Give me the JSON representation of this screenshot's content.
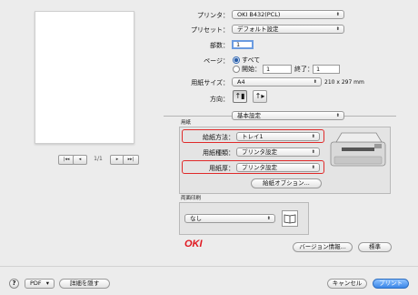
{
  "printer": {
    "label": "プリンタ：",
    "value": "OKI B432(PCL)"
  },
  "preset": {
    "label": "プリセット：",
    "value": "デフォルト設定"
  },
  "copies": {
    "label": "部数：",
    "value": "1"
  },
  "pages": {
    "label": "ページ：",
    "all_label": "すべて",
    "from_label": "開始：",
    "from_value": "1",
    "to_label": "終了：",
    "to_value": "1"
  },
  "paper_size": {
    "label": "用紙サイズ：",
    "value": "A4",
    "dimensions": "210 x 297 mm"
  },
  "orientation": {
    "label": "方向：",
    "portrait_glyph": "↑▮",
    "landscape_glyph": "↑▸"
  },
  "preview_nav": {
    "first": "|◂◂",
    "prev": "◂",
    "page": "1/1",
    "next": "▸",
    "last": "▸▸|"
  },
  "section": {
    "value": "基本設定"
  },
  "paper_group": {
    "title": "用紙",
    "source_label": "給紙方法：",
    "source_value": "トレイ1",
    "type_label": "用紙種類：",
    "type_value": "プリンタ設定",
    "weight_label": "用紙厚：",
    "weight_value": "プリンタ設定",
    "options_button": "給紙オプション..."
  },
  "duplex_group": {
    "title": "両面印刷",
    "value": "なし"
  },
  "brand": {
    "logo_text": "OKI",
    "color": "#e0171f"
  },
  "buttons": {
    "version": "バージョン情報...",
    "default": "標準",
    "help": "?",
    "pdf": "PDF",
    "hide_details": "詳細を隠す",
    "cancel": "キャンセル",
    "print": "プリント"
  },
  "arrow_glyph": "⬍",
  "pdf_arrow": "▾",
  "accent_color": "#3a86e8",
  "highlight_color": "#e02a2a"
}
